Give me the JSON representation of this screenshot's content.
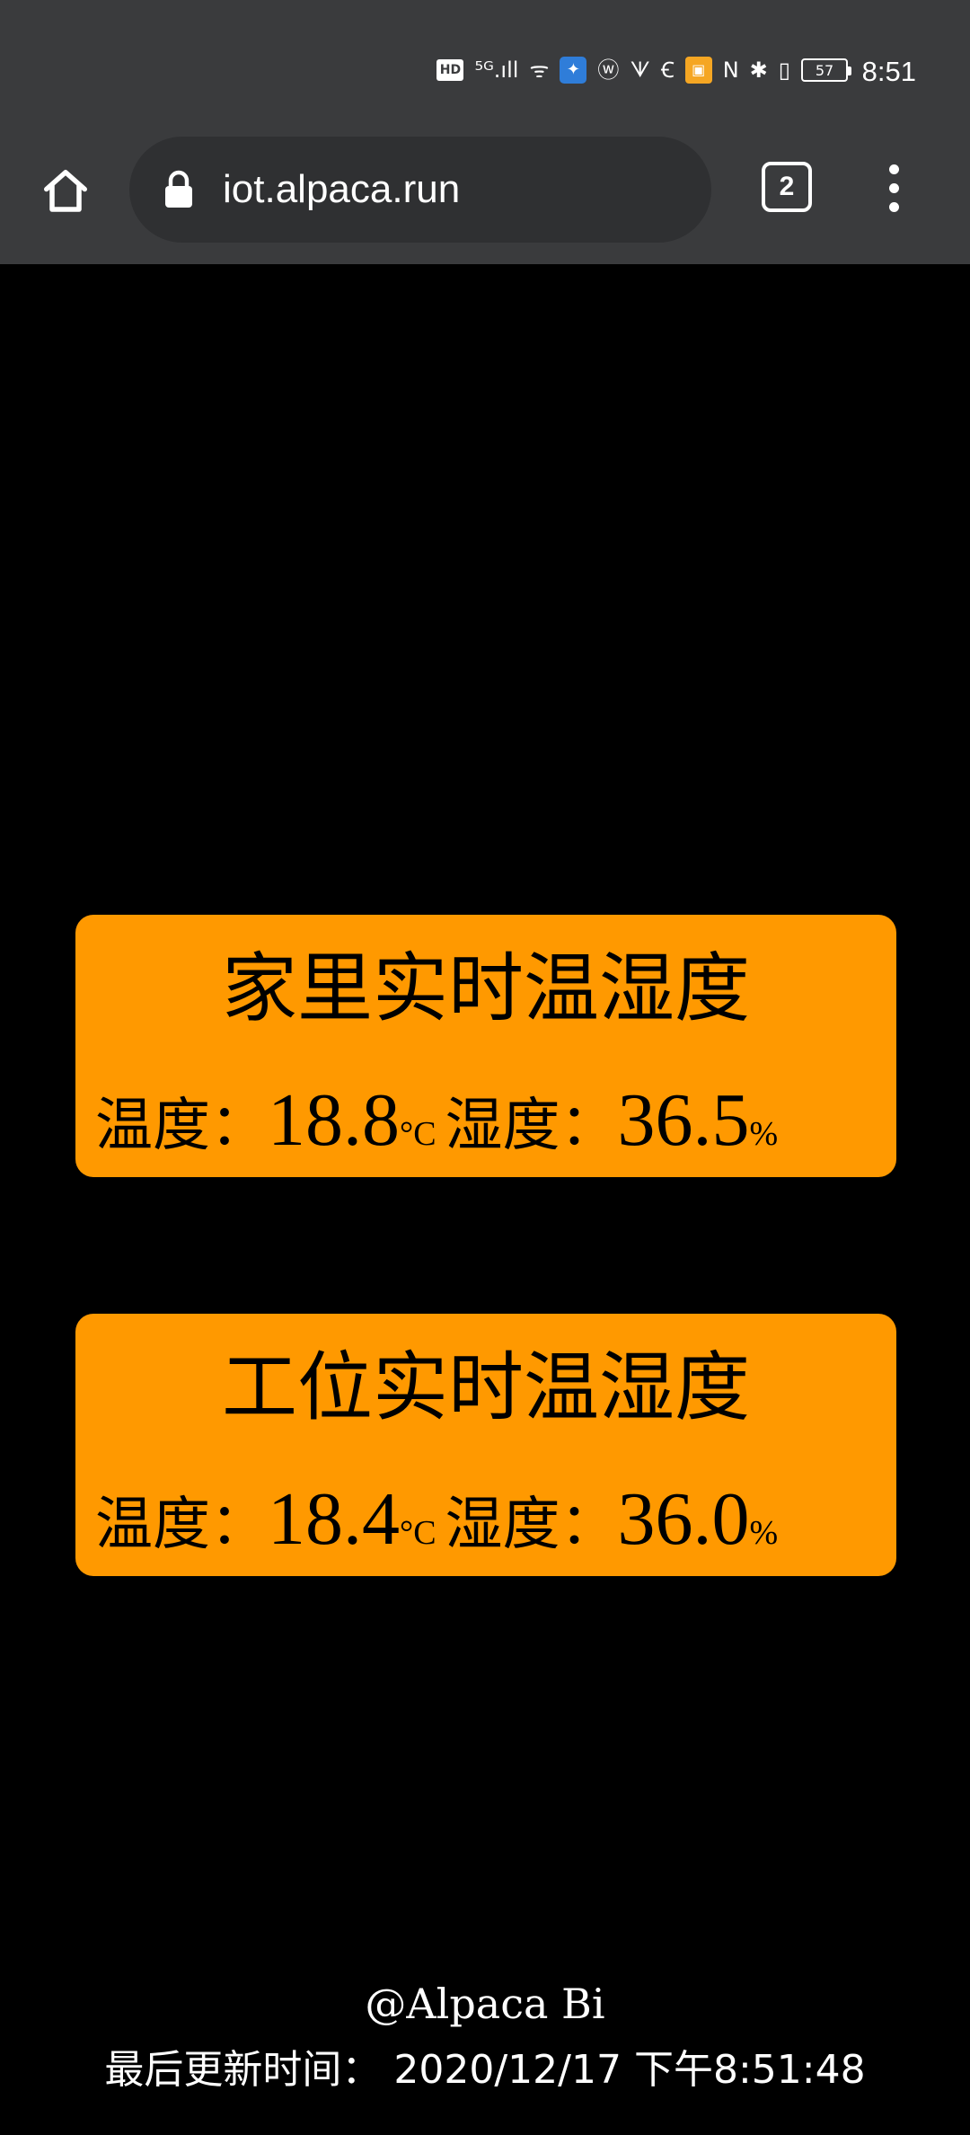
{
  "status_bar": {
    "time": "8:51",
    "battery_level": "57",
    "icons": [
      "hd-icon",
      "5g-signal-icon",
      "wifi-icon",
      "app-notification-icon",
      "weibo-icon",
      "app-icon",
      "browser-notification-icon",
      "image-notification-icon",
      "nfc-icon",
      "bluetooth-icon",
      "vibrate-icon",
      "battery-icon"
    ],
    "labels": {
      "hd": "HD",
      "signal": "⁵ᴳ.ıll",
      "wifi": "ᯤ",
      "notify_app": "✦",
      "weibo": "ⓦ",
      "app": "ᗐ",
      "browser": "Ꞓ",
      "image": "▣",
      "nfc": "N",
      "bluetooth": "✱",
      "vibrate": "▯"
    }
  },
  "browser": {
    "url": "iot.alpaca.run",
    "tab_count": "2"
  },
  "cards": [
    {
      "title": "家里实时温湿度",
      "temp_label": "温度：",
      "temp_value": "18.8",
      "temp_unit": "°C",
      "hum_label": "湿度：",
      "hum_value": "36.5",
      "hum_unit": "%"
    },
    {
      "title": "工位实时温湿度",
      "temp_label": "温度：",
      "temp_value": "18.4",
      "temp_unit": "°C",
      "hum_label": "湿度：",
      "hum_value": "36.0",
      "hum_unit": "%"
    }
  ],
  "footer": {
    "author": "@Alpaca Bi",
    "updated": "最后更新时间： 2020/12/17 下午8:51:48"
  },
  "colors": {
    "background": "#000000",
    "chrome": "#3a3b3d",
    "card": "#ff9900",
    "text_light": "#ffffff",
    "text_dark": "#000000"
  }
}
